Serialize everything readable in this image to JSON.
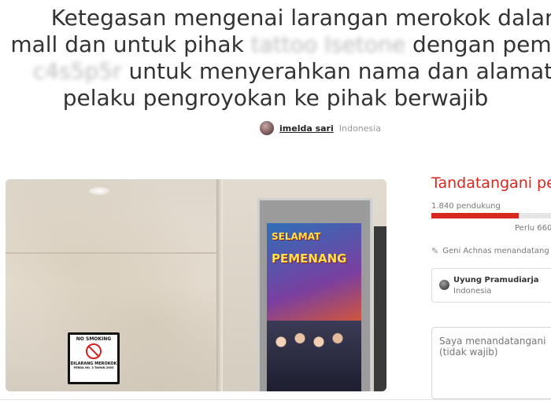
{
  "petition": {
    "title_lines": [
      "Ketegasan mengenai larangan merokok dalam",
      "mall dan untuk pihak",
      "dengan pem",
      "untuk menyerahkan nama dan alamat",
      "pelaku pengroyokan ke pihak berwajib"
    ],
    "redacted_1": "tattoo Isetone",
    "redacted_2": "c4s5p5r",
    "author_name": "imelda sari",
    "author_location": "Indonesia"
  },
  "photo": {
    "no_smoking_top": "NO SMOKING",
    "no_smoking_bottom": "DILARANG MEROKOK",
    "no_smoking_small": "PERDA NO. 3 TAHUN 2005",
    "poster_line1": "SELAMAT",
    "poster_line2": "PEMENANG"
  },
  "sidebar": {
    "sign_title": "Tandatangani pe",
    "supporters_text": "1.840 pendukung",
    "progress_fraction": 0.73,
    "needed_text": "Perlu 660",
    "activity_text": "Geni Achnas menandatang",
    "signer_name": "Uyung Pramudiarja",
    "signer_location": "Indonesia",
    "comment_placeholder": "Saya menandatangani\n(tidak wajib)"
  },
  "colors": {
    "accent": "#d8271f",
    "text": "#333333",
    "muted": "#777777"
  }
}
